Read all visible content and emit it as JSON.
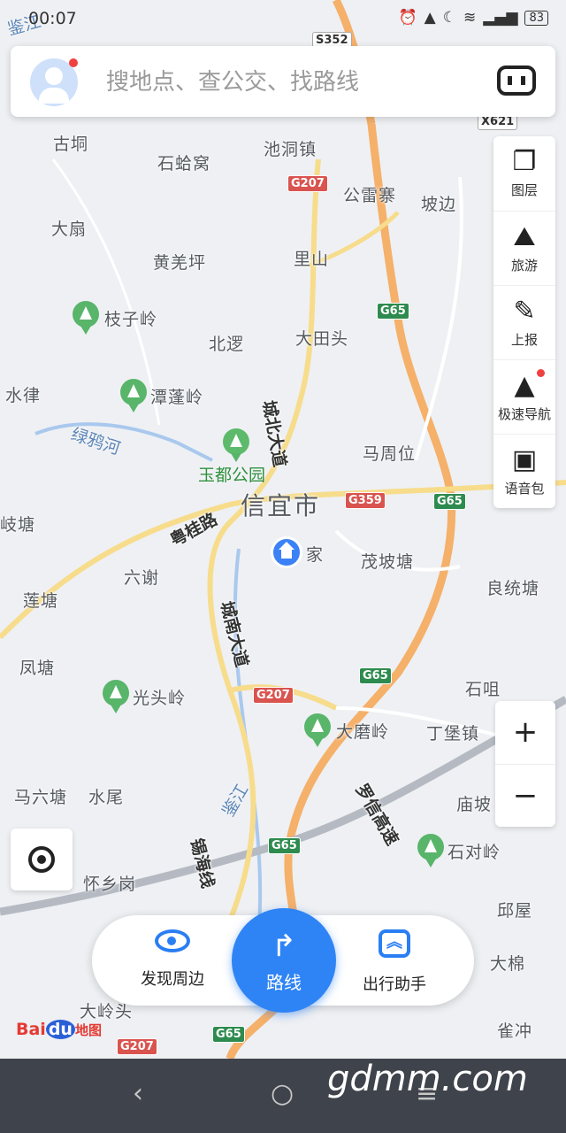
{
  "status": {
    "time": "00:07",
    "battery": "83"
  },
  "search": {
    "placeholder": "搜地点、查公交、找路线"
  },
  "tools": [
    {
      "label": "图层"
    },
    {
      "label": "旅游"
    },
    {
      "label": "上报"
    },
    {
      "label": "极速导航"
    },
    {
      "label": "语音包"
    }
  ],
  "zoom": {
    "in": "+",
    "out": "−"
  },
  "bottom": {
    "nearby": "发现周边",
    "route": "路线",
    "assistant": "出行助手"
  },
  "logo": {
    "bai": "Bai",
    "du": "du",
    "map": "地图"
  },
  "watermark": "gdmm.com",
  "map": {
    "city": "信宜市",
    "home": "家",
    "park": "玉都公园",
    "places": [
      "古垌",
      "石蛤窝",
      "池洞镇",
      "公雷寨",
      "坡边",
      "大扇",
      "黄羌坪",
      "里山",
      "枝子岭",
      "北逻",
      "大田头",
      "水律",
      "潭蓬岭",
      "马周位",
      "茂坡塘",
      "良统塘",
      "六谢",
      "莲塘",
      "凤塘",
      "光头岭",
      "石咀",
      "大磨岭",
      "丁堡镇",
      "马六塘",
      "水尾",
      "庙坡",
      "石对岭",
      "怀乡岗",
      "邱屋",
      "大棉",
      "大岭头",
      "雀冲",
      "古垌",
      "岐塘"
    ],
    "roads": [
      "城北大道",
      "粤桂路",
      "城南大道",
      "锡海线",
      "罗信高速"
    ],
    "rivers": [
      "绿鸦河",
      "鉴江",
      "鉴江"
    ],
    "shields": [
      "S352",
      "G207",
      "G65",
      "G359",
      "G65",
      "G207",
      "G65",
      "G65",
      "G207",
      "G65",
      "X621"
    ]
  }
}
